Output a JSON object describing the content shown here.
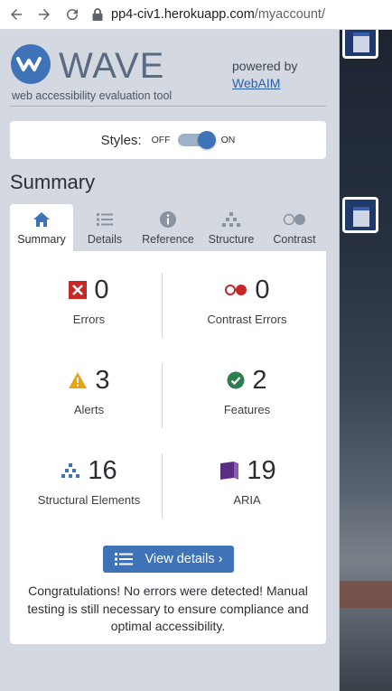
{
  "browser": {
    "url_host": "pp4-civ1.herokuapp.com",
    "url_path": "/myaccount/"
  },
  "wave": {
    "logo_text": "WAVE",
    "tagline": "web accessibility evaluation tool",
    "powered_by": "powered by",
    "webaim_link": "WebAIM"
  },
  "styles": {
    "label": "Styles:",
    "off": "OFF",
    "on": "ON",
    "state": "on"
  },
  "summary_heading": "Summary",
  "tabs": [
    {
      "label": "Summary",
      "icon": "home-icon",
      "active": true
    },
    {
      "label": "Details",
      "icon": "list-icon",
      "active": false
    },
    {
      "label": "Reference",
      "icon": "info-icon",
      "active": false
    },
    {
      "label": "Structure",
      "icon": "hierarchy-icon",
      "active": false
    },
    {
      "label": "Contrast",
      "icon": "contrast-icon",
      "active": false
    }
  ],
  "stats": [
    {
      "count": "0",
      "label": "Errors",
      "icon": "error-icon",
      "color": "#c62828"
    },
    {
      "count": "0",
      "label": "Contrast Errors",
      "icon": "contrast-error-icon",
      "color": "#c62828"
    },
    {
      "count": "3",
      "label": "Alerts",
      "icon": "alert-icon",
      "color": "#e8a317"
    },
    {
      "count": "2",
      "label": "Features",
      "icon": "feature-icon",
      "color": "#2e7d4f"
    },
    {
      "count": "16",
      "label": "Structural Elements",
      "icon": "structure-icon",
      "color": "#3f73b8"
    },
    {
      "count": "19",
      "label": "ARIA",
      "icon": "aria-icon",
      "color": "#5a2d82"
    }
  ],
  "view_details": "View details ›",
  "congrats": "Congratulations! No errors were detected! Manual testing is still necessary to ensure compliance and optimal accessibility."
}
